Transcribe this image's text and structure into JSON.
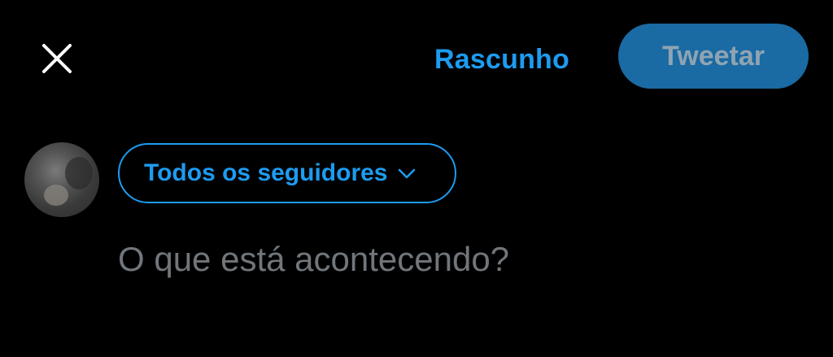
{
  "colors": {
    "background": "#000000",
    "accent": "#1d9bf0",
    "tweet_button_bg": "#1a6aa3",
    "tweet_button_text": "#8fa4b3",
    "placeholder": "#71767b",
    "close_icon": "#ffffff"
  },
  "header": {
    "close_icon": "close-icon",
    "draft_label": "Rascunho",
    "tweet_label": "Tweetar"
  },
  "composer": {
    "avatar": "user-avatar",
    "audience_label": "Todos os seguidores",
    "audience_icon": "chevron-down-icon",
    "placeholder": "O que está acontecendo?"
  }
}
